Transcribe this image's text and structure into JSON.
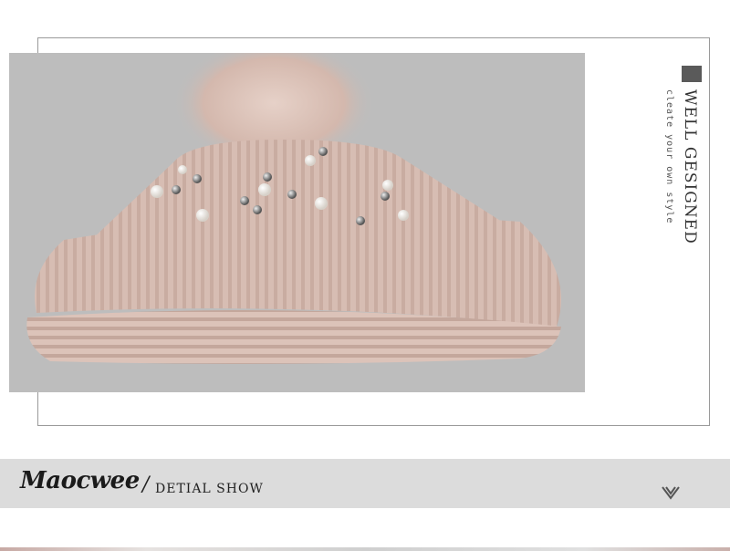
{
  "side_panel": {
    "title": "WELL GESIGNED",
    "subtitle": "cleate your own style"
  },
  "banner": {
    "brand": "Maocwee",
    "slash": "/",
    "section_label": "DETIAL SHOW",
    "indicator_icon": "double-chevron-down-icon"
  },
  "product_image": {
    "subject": "pink knit beanie with fur pom-pom and pearl studs"
  },
  "colors": {
    "banner_bg": "#dcdcdc",
    "photo_bg": "#bdbdbd",
    "hat": "#d9beb4",
    "accent_dark": "#5a5a5a"
  }
}
